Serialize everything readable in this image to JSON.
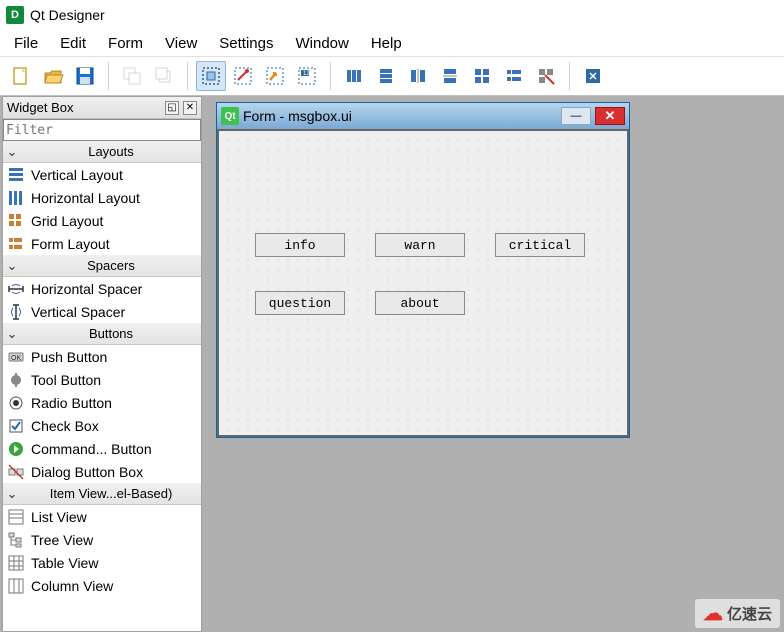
{
  "app": {
    "icon_letter": "D",
    "title": "Qt Designer"
  },
  "menu": {
    "file": "File",
    "edit": "Edit",
    "form": "Form",
    "view": "View",
    "settings": "Settings",
    "window": "Window",
    "help": "Help"
  },
  "widgetbox": {
    "title": "Widget Box",
    "filter_placeholder": "Filter",
    "categories": {
      "layouts": {
        "label": "Layouts",
        "items": [
          {
            "label": "Vertical Layout"
          },
          {
            "label": "Horizontal Layout"
          },
          {
            "label": "Grid Layout"
          },
          {
            "label": "Form Layout"
          }
        ]
      },
      "spacers": {
        "label": "Spacers",
        "items": [
          {
            "label": "Horizontal Spacer"
          },
          {
            "label": "Vertical Spacer"
          }
        ]
      },
      "buttons": {
        "label": "Buttons",
        "items": [
          {
            "label": "Push Button"
          },
          {
            "label": "Tool Button"
          },
          {
            "label": "Radio Button"
          },
          {
            "label": "Check Box"
          },
          {
            "label": "Command... Button"
          },
          {
            "label": "Dialog Button Box"
          }
        ]
      },
      "itemviews": {
        "label": "Item View...el-Based)",
        "items": [
          {
            "label": "List View"
          },
          {
            "label": "Tree View"
          },
          {
            "label": "Table View"
          },
          {
            "label": "Column View"
          }
        ]
      }
    }
  },
  "form": {
    "qt_badge": "Qt",
    "title": "Form - msgbox.ui",
    "buttons": {
      "info": "info",
      "warn": "warn",
      "critical": "critical",
      "question": "question",
      "about": "about"
    }
  },
  "watermark": {
    "text": "亿速云"
  }
}
